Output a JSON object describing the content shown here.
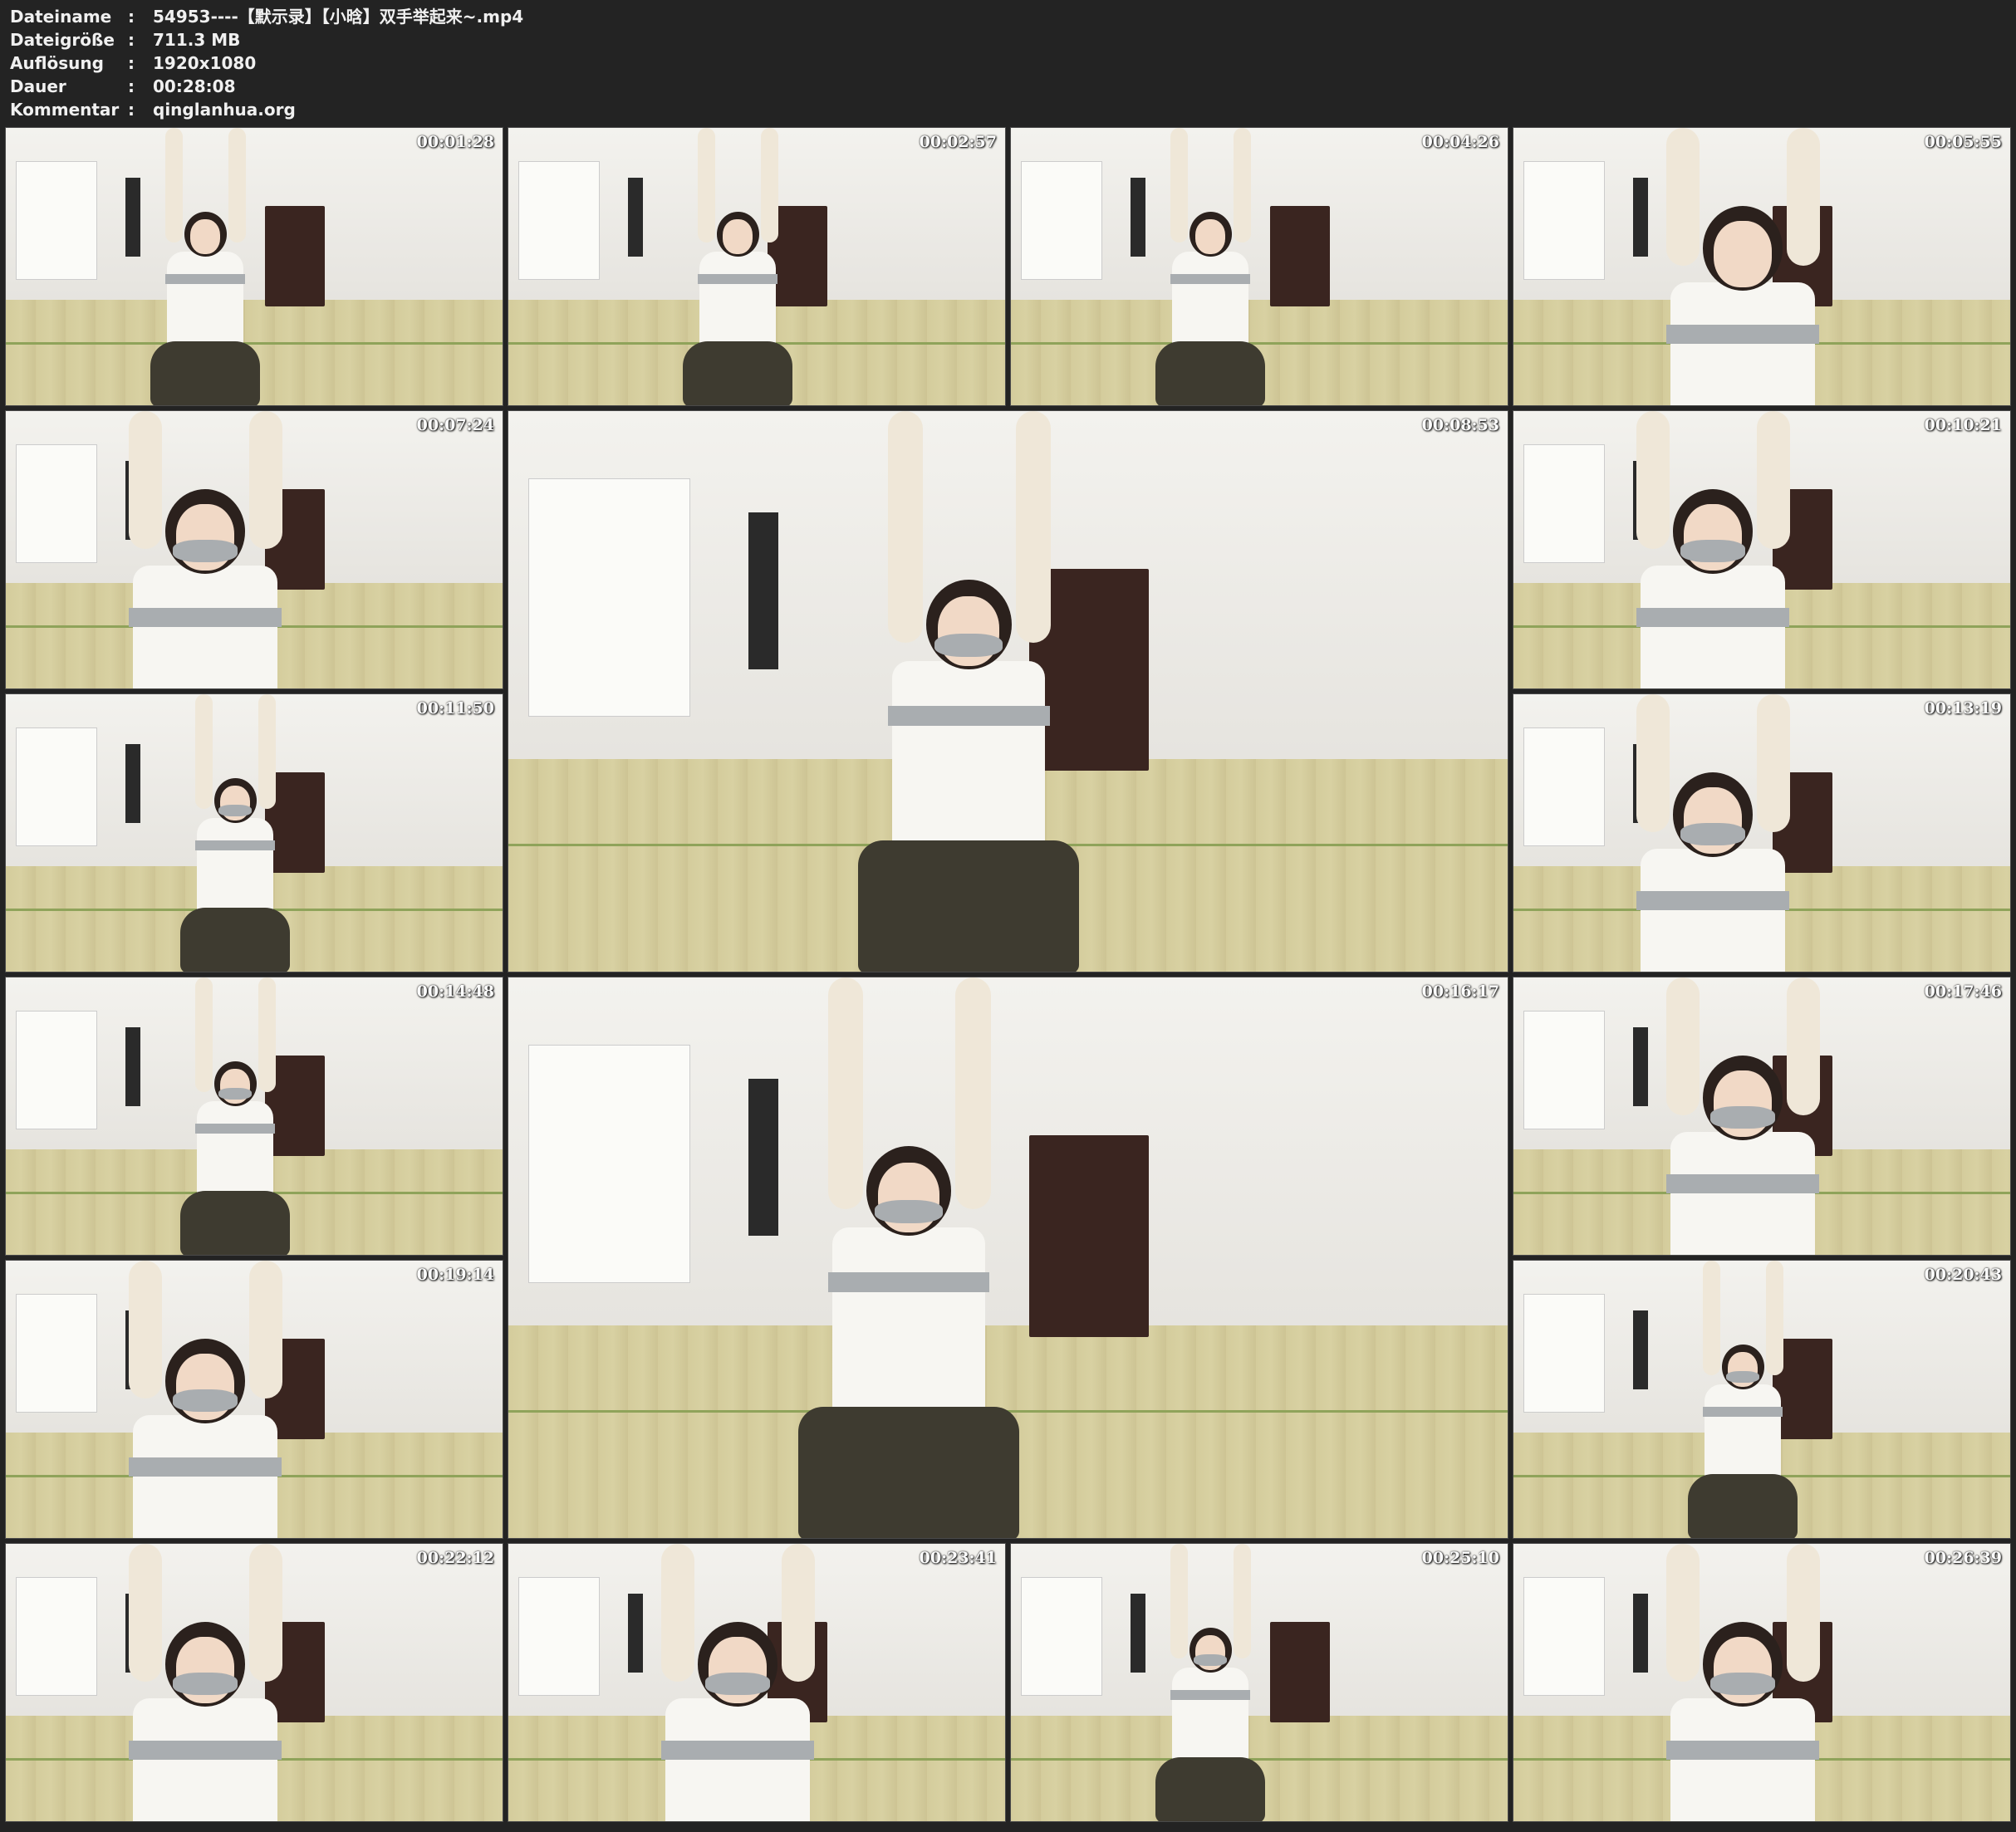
{
  "meta": {
    "rows": [
      {
        "key": "Dateiname",
        "sep": ":",
        "value": "54953----【默示录】【小晗】双手举起来~.mp4"
      },
      {
        "key": "Dateigröße",
        "sep": ":",
        "value": "711.3 MB"
      },
      {
        "key": "Auflösung",
        "sep": ":",
        "value": "1920x1080"
      },
      {
        "key": "Dauer",
        "sep": ":",
        "value": "00:28:08"
      },
      {
        "key": "Kommentar",
        "sep": ":",
        "value": "qinglanhua.org"
      }
    ]
  },
  "thumbnails": [
    {
      "time": "00:01:28"
    },
    {
      "time": "00:02:57"
    },
    {
      "time": "00:04:26"
    },
    {
      "time": "00:05:55"
    },
    {
      "time": "00:07:24"
    },
    {
      "time": "00:08:53"
    },
    {
      "time": "00:10:21"
    },
    {
      "time": "00:11:50"
    },
    {
      "time": "00:13:19"
    },
    {
      "time": "00:14:48"
    },
    {
      "time": "00:16:17"
    },
    {
      "time": "00:17:46"
    },
    {
      "time": "00:19:14"
    },
    {
      "time": "00:20:43"
    },
    {
      "time": "00:22:12"
    },
    {
      "time": "00:23:41"
    },
    {
      "time": "00:25:10"
    },
    {
      "time": "00:26:39"
    }
  ]
}
